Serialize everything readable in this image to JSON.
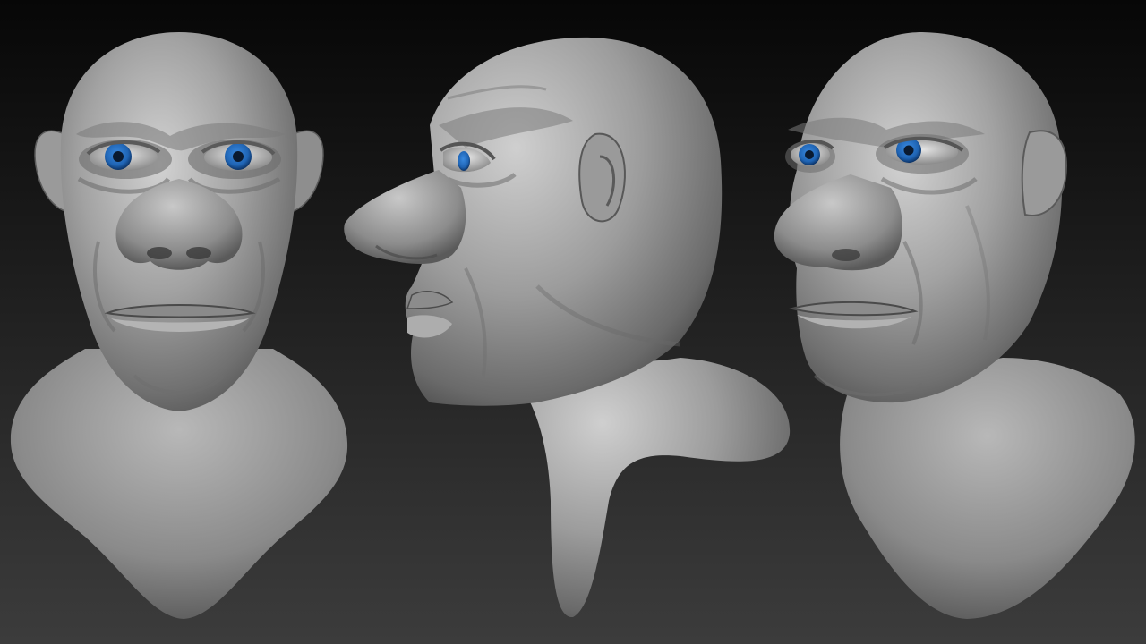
{
  "scene": {
    "background_top": "#070707",
    "background_bottom": "#3c3c3c",
    "clay_color": "#8e8e8e",
    "iris_color": "#1f64b4",
    "views": [
      {
        "id": "front",
        "kind": "front-view"
      },
      {
        "id": "side",
        "kind": "side-profile"
      },
      {
        "id": "three-quarter",
        "kind": "three-quarter-view"
      }
    ]
  }
}
